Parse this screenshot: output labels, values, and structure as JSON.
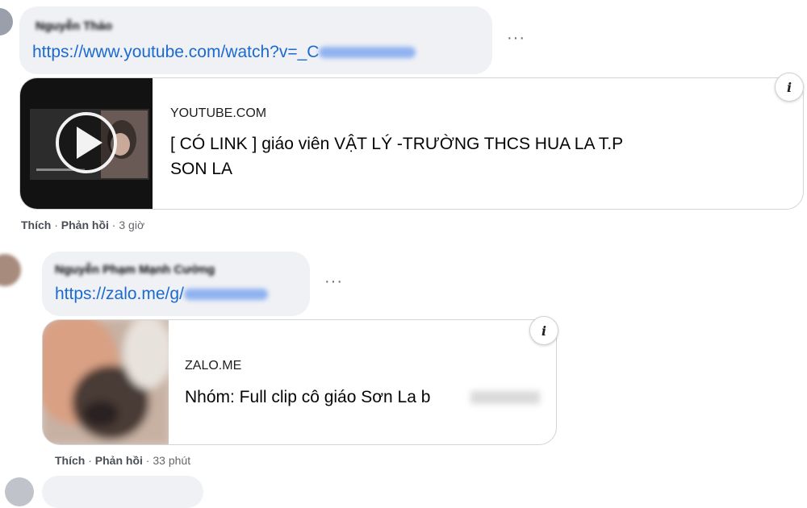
{
  "comments": [
    {
      "author": "Nguyễn Thảo",
      "link_text": "https://www.youtube.com/watch?v=_C",
      "more_label": "···",
      "preview": {
        "domain": "YOUTUBE.COM",
        "title": "[ CÓ LINK ] giáo viên VẬT LÝ -TRƯỜNG THCS HUA LA T.P SON LA",
        "info_label": "i",
        "thumbnail_icon": "play-icon"
      },
      "actions": {
        "like": "Thích",
        "sep1": " · ",
        "reply": "Phản hồi",
        "sep2": " · ",
        "time": "3 giờ"
      }
    },
    {
      "author": "Nguyễn Phạm Mạnh Cường",
      "link_text": "https://zalo.me/g/",
      "more_label": "···",
      "preview": {
        "domain": "ZALO.ME",
        "title": "Nhóm: Full clip cô giáo Sơn La b",
        "info_label": "i"
      },
      "actions": {
        "like": "Thích",
        "sep1": " · ",
        "reply": "Phản hồi",
        "sep2": " · ",
        "time": "33 phút"
      }
    }
  ]
}
